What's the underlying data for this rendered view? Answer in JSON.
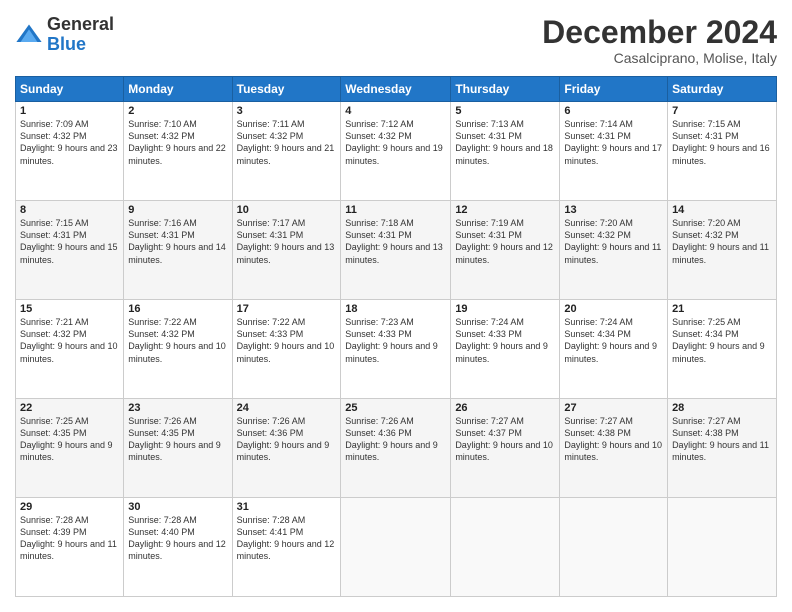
{
  "logo": {
    "general": "General",
    "blue": "Blue"
  },
  "title": "December 2024",
  "subtitle": "Casalciprano, Molise, Italy",
  "days_of_week": [
    "Sunday",
    "Monday",
    "Tuesday",
    "Wednesday",
    "Thursday",
    "Friday",
    "Saturday"
  ],
  "weeks": [
    [
      {
        "day": "1",
        "sunrise": "7:09 AM",
        "sunset": "4:32 PM",
        "daylight": "9 hours and 23 minutes."
      },
      {
        "day": "2",
        "sunrise": "7:10 AM",
        "sunset": "4:32 PM",
        "daylight": "9 hours and 22 minutes."
      },
      {
        "day": "3",
        "sunrise": "7:11 AM",
        "sunset": "4:32 PM",
        "daylight": "9 hours and 21 minutes."
      },
      {
        "day": "4",
        "sunrise": "7:12 AM",
        "sunset": "4:32 PM",
        "daylight": "9 hours and 19 minutes."
      },
      {
        "day": "5",
        "sunrise": "7:13 AM",
        "sunset": "4:31 PM",
        "daylight": "9 hours and 18 minutes."
      },
      {
        "day": "6",
        "sunrise": "7:14 AM",
        "sunset": "4:31 PM",
        "daylight": "9 hours and 17 minutes."
      },
      {
        "day": "7",
        "sunrise": "7:15 AM",
        "sunset": "4:31 PM",
        "daylight": "9 hours and 16 minutes."
      }
    ],
    [
      {
        "day": "8",
        "sunrise": "7:15 AM",
        "sunset": "4:31 PM",
        "daylight": "9 hours and 15 minutes."
      },
      {
        "day": "9",
        "sunrise": "7:16 AM",
        "sunset": "4:31 PM",
        "daylight": "9 hours and 14 minutes."
      },
      {
        "day": "10",
        "sunrise": "7:17 AM",
        "sunset": "4:31 PM",
        "daylight": "9 hours and 13 minutes."
      },
      {
        "day": "11",
        "sunrise": "7:18 AM",
        "sunset": "4:31 PM",
        "daylight": "9 hours and 13 minutes."
      },
      {
        "day": "12",
        "sunrise": "7:19 AM",
        "sunset": "4:31 PM",
        "daylight": "9 hours and 12 minutes."
      },
      {
        "day": "13",
        "sunrise": "7:20 AM",
        "sunset": "4:32 PM",
        "daylight": "9 hours and 11 minutes."
      },
      {
        "day": "14",
        "sunrise": "7:20 AM",
        "sunset": "4:32 PM",
        "daylight": "9 hours and 11 minutes."
      }
    ],
    [
      {
        "day": "15",
        "sunrise": "7:21 AM",
        "sunset": "4:32 PM",
        "daylight": "9 hours and 10 minutes."
      },
      {
        "day": "16",
        "sunrise": "7:22 AM",
        "sunset": "4:32 PM",
        "daylight": "9 hours and 10 minutes."
      },
      {
        "day": "17",
        "sunrise": "7:22 AM",
        "sunset": "4:33 PM",
        "daylight": "9 hours and 10 minutes."
      },
      {
        "day": "18",
        "sunrise": "7:23 AM",
        "sunset": "4:33 PM",
        "daylight": "9 hours and 9 minutes."
      },
      {
        "day": "19",
        "sunrise": "7:24 AM",
        "sunset": "4:33 PM",
        "daylight": "9 hours and 9 minutes."
      },
      {
        "day": "20",
        "sunrise": "7:24 AM",
        "sunset": "4:34 PM",
        "daylight": "9 hours and 9 minutes."
      },
      {
        "day": "21",
        "sunrise": "7:25 AM",
        "sunset": "4:34 PM",
        "daylight": "9 hours and 9 minutes."
      }
    ],
    [
      {
        "day": "22",
        "sunrise": "7:25 AM",
        "sunset": "4:35 PM",
        "daylight": "9 hours and 9 minutes."
      },
      {
        "day": "23",
        "sunrise": "7:26 AM",
        "sunset": "4:35 PM",
        "daylight": "9 hours and 9 minutes."
      },
      {
        "day": "24",
        "sunrise": "7:26 AM",
        "sunset": "4:36 PM",
        "daylight": "9 hours and 9 minutes."
      },
      {
        "day": "25",
        "sunrise": "7:26 AM",
        "sunset": "4:36 PM",
        "daylight": "9 hours and 9 minutes."
      },
      {
        "day": "26",
        "sunrise": "7:27 AM",
        "sunset": "4:37 PM",
        "daylight": "9 hours and 10 minutes."
      },
      {
        "day": "27",
        "sunrise": "7:27 AM",
        "sunset": "4:38 PM",
        "daylight": "9 hours and 10 minutes."
      },
      {
        "day": "28",
        "sunrise": "7:27 AM",
        "sunset": "4:38 PM",
        "daylight": "9 hours and 11 minutes."
      }
    ],
    [
      {
        "day": "29",
        "sunrise": "7:28 AM",
        "sunset": "4:39 PM",
        "daylight": "9 hours and 11 minutes."
      },
      {
        "day": "30",
        "sunrise": "7:28 AM",
        "sunset": "4:40 PM",
        "daylight": "9 hours and 12 minutes."
      },
      {
        "day": "31",
        "sunrise": "7:28 AM",
        "sunset": "4:41 PM",
        "daylight": "9 hours and 12 minutes."
      },
      null,
      null,
      null,
      null
    ]
  ]
}
